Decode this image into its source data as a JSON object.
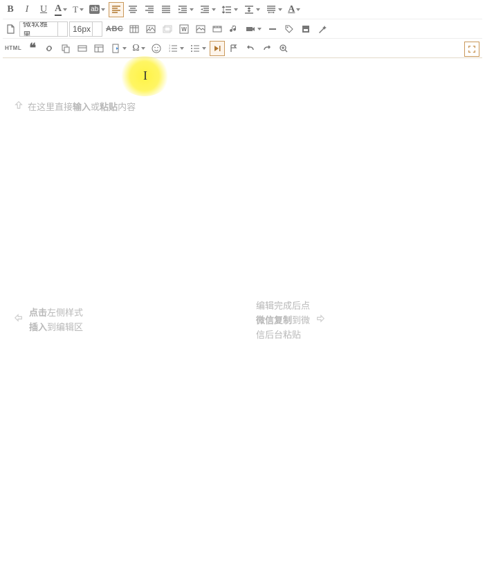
{
  "toolbar": {
    "row1": {
      "bold_letter": "B",
      "italic_letter": "I",
      "underline_letter": "U",
      "fontcolor_letter": "A",
      "fontcase_letter": "T",
      "bgcolor_letter": "ab",
      "clearformat_letter": "A"
    },
    "row2": {
      "font_family": "微软雅黑",
      "font_size": "16px",
      "abc_label": "ABC",
      "word_label": "W"
    },
    "row3": {
      "html_label": "HTML",
      "omega": "Ω"
    }
  },
  "editor": {
    "placeholder_prefix": "在这里直接",
    "placeholder_bold1": "输入",
    "placeholder_mid": "或",
    "placeholder_bold2": "粘贴",
    "placeholder_suffix": "内容"
  },
  "hints": {
    "left_line1a": "点击",
    "left_line1b": "左侧样式",
    "left_line2a": "插入",
    "left_line2b": "到编辑区",
    "right_line1": "编辑完成后点",
    "right_line2a": "微信复制",
    "right_line2b": "到微",
    "right_line3": "信后台粘贴"
  }
}
